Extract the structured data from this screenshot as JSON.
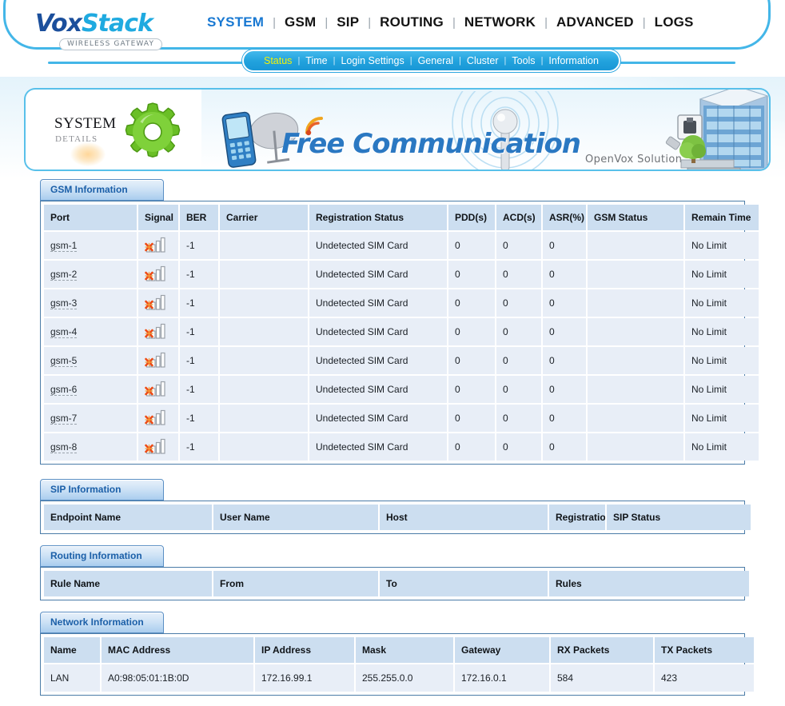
{
  "header": {
    "logo_vox": "Vox",
    "logo_stack": "Stack",
    "logo_subtitle": "WIRELESS GATEWAY",
    "main_nav": [
      {
        "label": "SYSTEM",
        "active": true
      },
      {
        "label": "GSM",
        "active": false
      },
      {
        "label": "SIP",
        "active": false
      },
      {
        "label": "ROUTING",
        "active": false
      },
      {
        "label": "NETWORK",
        "active": false
      },
      {
        "label": "ADVANCED",
        "active": false
      },
      {
        "label": "LOGS",
        "active": false
      }
    ],
    "sub_nav": [
      {
        "label": "Status",
        "active": true
      },
      {
        "label": "Time",
        "active": false
      },
      {
        "label": "Login Settings",
        "active": false
      },
      {
        "label": "General",
        "active": false
      },
      {
        "label": "Cluster",
        "active": false
      },
      {
        "label": "Tools",
        "active": false
      },
      {
        "label": "Information",
        "active": false
      }
    ],
    "nav_separator": "|",
    "colors": {
      "active_nav": "#1878d2",
      "active_subnav": "#f4f207",
      "frame_blue": "#43b6e8",
      "pill_blue": "#22a2dd"
    }
  },
  "banner": {
    "system_title": "SYSTEM",
    "system_subtitle": "DETAILS",
    "headline": "Free Communication",
    "tagline": "OpenVox Solution",
    "icons": {
      "gear": "gear-icon",
      "phone": "mobile-phone-icon",
      "satellite": "satellite-dish-icon",
      "antenna": "antenna-signal-icon",
      "rss": "rss-wave-icon",
      "building": "office-building-icon",
      "rj45": "rj45-connector-icon",
      "tree": "tree-icon"
    }
  },
  "sections": {
    "gsm": {
      "title": "GSM Information",
      "columns": [
        "Port",
        "Signal",
        "BER",
        "Carrier",
        "Registration Status",
        "PDD(s)",
        "ACD(s)",
        "ASR(%)",
        "GSM Status",
        "Remain Time"
      ],
      "signal_icon": "no-signal-icon",
      "rows": [
        {
          "port": "gsm-1",
          "signal": "no-signal-icon",
          "ber": "-1",
          "carrier": "",
          "registration_status": "Undetected SIM Card",
          "pdd": "0",
          "acd": "0",
          "asr": "0",
          "gsm_status": "",
          "remain_time": "No Limit"
        },
        {
          "port": "gsm-2",
          "signal": "no-signal-icon",
          "ber": "-1",
          "carrier": "",
          "registration_status": "Undetected SIM Card",
          "pdd": "0",
          "acd": "0",
          "asr": "0",
          "gsm_status": "",
          "remain_time": "No Limit"
        },
        {
          "port": "gsm-3",
          "signal": "no-signal-icon",
          "ber": "-1",
          "carrier": "",
          "registration_status": "Undetected SIM Card",
          "pdd": "0",
          "acd": "0",
          "asr": "0",
          "gsm_status": "",
          "remain_time": "No Limit"
        },
        {
          "port": "gsm-4",
          "signal": "no-signal-icon",
          "ber": "-1",
          "carrier": "",
          "registration_status": "Undetected SIM Card",
          "pdd": "0",
          "acd": "0",
          "asr": "0",
          "gsm_status": "",
          "remain_time": "No Limit"
        },
        {
          "port": "gsm-5",
          "signal": "no-signal-icon",
          "ber": "-1",
          "carrier": "",
          "registration_status": "Undetected SIM Card",
          "pdd": "0",
          "acd": "0",
          "asr": "0",
          "gsm_status": "",
          "remain_time": "No Limit"
        },
        {
          "port": "gsm-6",
          "signal": "no-signal-icon",
          "ber": "-1",
          "carrier": "",
          "registration_status": "Undetected SIM Card",
          "pdd": "0",
          "acd": "0",
          "asr": "0",
          "gsm_status": "",
          "remain_time": "No Limit"
        },
        {
          "port": "gsm-7",
          "signal": "no-signal-icon",
          "ber": "-1",
          "carrier": "",
          "registration_status": "Undetected SIM Card",
          "pdd": "0",
          "acd": "0",
          "asr": "0",
          "gsm_status": "",
          "remain_time": "No Limit"
        },
        {
          "port": "gsm-8",
          "signal": "no-signal-icon",
          "ber": "-1",
          "carrier": "",
          "registration_status": "Undetected SIM Card",
          "pdd": "0",
          "acd": "0",
          "asr": "0",
          "gsm_status": "",
          "remain_time": "No Limit"
        }
      ]
    },
    "sip": {
      "title": "SIP Information",
      "columns": [
        "Endpoint Name",
        "User Name",
        "Host",
        "Registration",
        "SIP Status"
      ],
      "rows": []
    },
    "routing": {
      "title": "Routing Information",
      "columns": [
        "Rule Name",
        "From",
        "To",
        "Rules"
      ],
      "rows": []
    },
    "network": {
      "title": "Network Information",
      "columns": [
        "Name",
        "MAC Address",
        "IP Address",
        "Mask",
        "Gateway",
        "RX Packets",
        "TX Packets"
      ],
      "rows": [
        {
          "name": "LAN",
          "mac": "A0:98:05:01:1B:0D",
          "ip": "172.16.99.1",
          "mask": "255.255.0.0",
          "gateway": "172.16.0.1",
          "rx": "584",
          "tx": "423"
        }
      ]
    }
  }
}
